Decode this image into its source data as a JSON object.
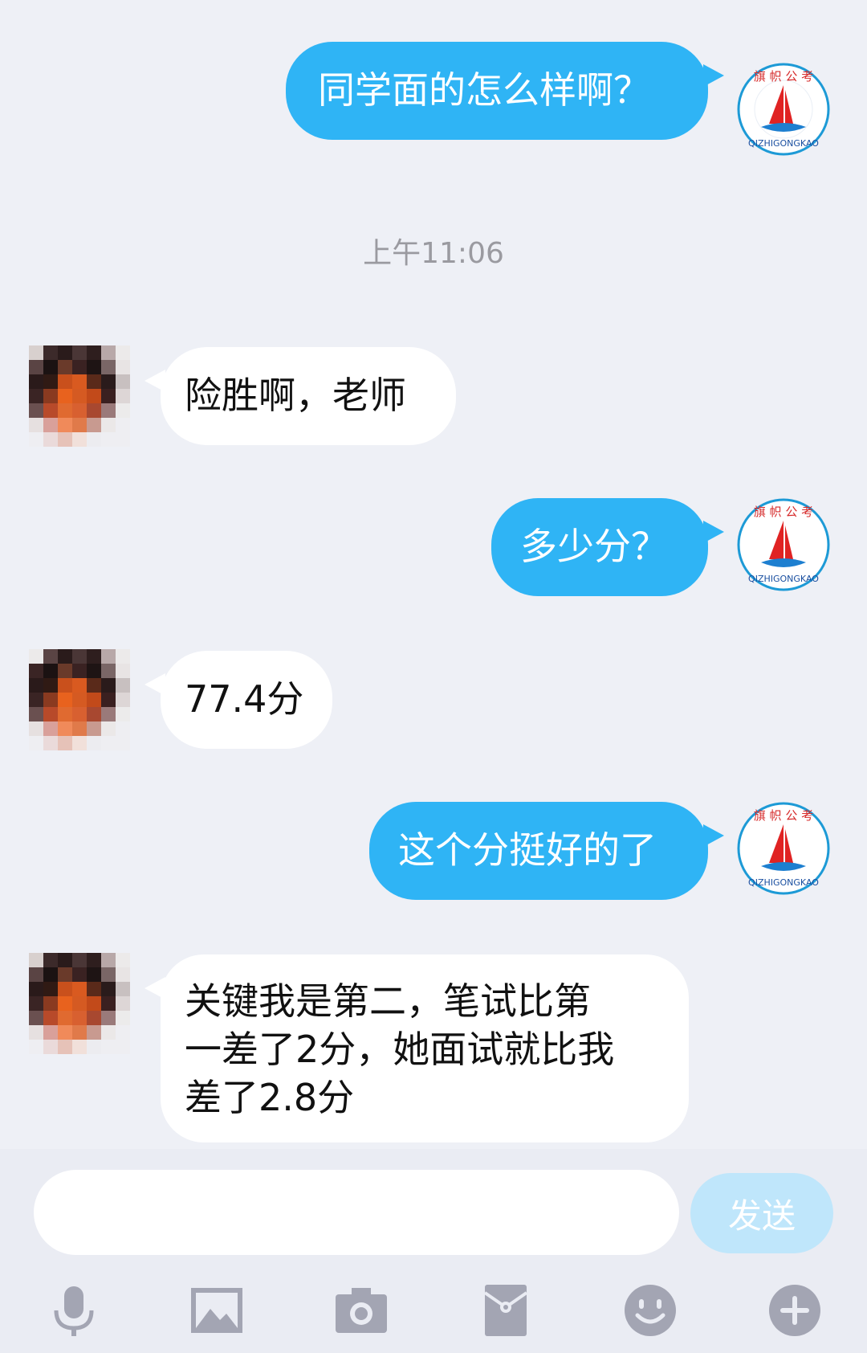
{
  "messages": [
    {
      "side": "out",
      "text": "同学面的怎么样啊？"
    },
    {
      "side": "in",
      "text": "险胜啊，老师"
    },
    {
      "side": "out",
      "text": "多少分？"
    },
    {
      "side": "in",
      "text": "77.4分"
    },
    {
      "side": "out",
      "text": "这个分挺好的了"
    },
    {
      "side": "in",
      "lines": [
        "关键我是第二，笔试比第",
        "一差了2分，她面试就比我",
        "差了2.8分"
      ]
    }
  ],
  "timestamp": "上午11:06",
  "logo_text": "QIZHIGONGKAO",
  "logo_cn": "旗 帜 公 考",
  "input": {
    "value": "",
    "placeholder": ""
  },
  "send_label": "发送",
  "toolbar": [
    "microphone-icon",
    "image-icon",
    "camera-icon",
    "red-packet-icon",
    "emoji-icon",
    "plus-icon"
  ],
  "colors": {
    "outgoing_bubble": "#2fb4f5",
    "incoming_bubble": "#ffffff",
    "background": "#eef0f6",
    "send_button": "#bfe6fb",
    "icon_gray": "#a3a5b3"
  }
}
